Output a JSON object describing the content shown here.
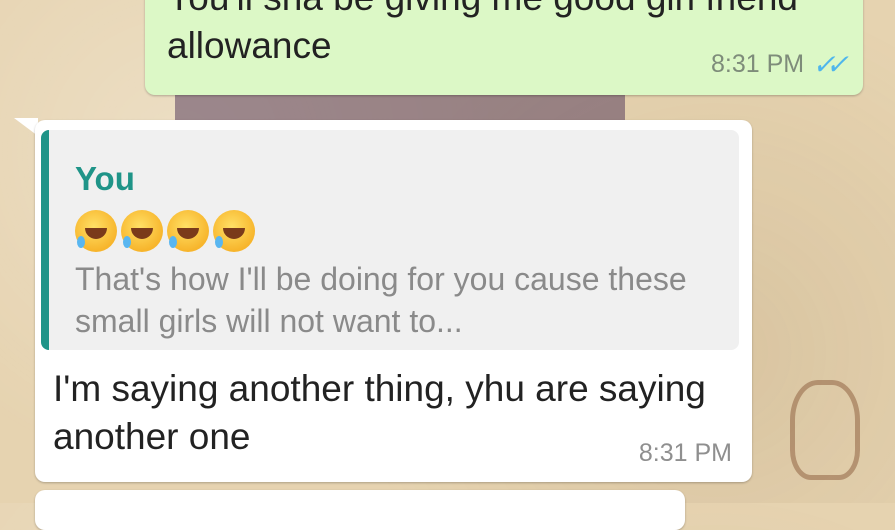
{
  "chat": {
    "outgoing": {
      "text": "You'll sha be giving me good girl friend allowance",
      "time": "8:31 PM",
      "status_icon": "double-check-read-icon"
    },
    "incoming": {
      "quoted": {
        "author": "You",
        "emoji_icon": "rolling-on-floor-laughing-emoji",
        "emoji_count": 4,
        "text": "That's how I'll be doing for you cause these small girls will not want to..."
      },
      "text": "I'm saying another thing, yhu are saying another one",
      "time": "8:31 PM"
    }
  },
  "colors": {
    "outgoing_bubble": "#dcf8c6",
    "incoming_bubble": "#ffffff",
    "quote_accent": "#1f9488",
    "read_ticks": "#4fb6ec"
  }
}
